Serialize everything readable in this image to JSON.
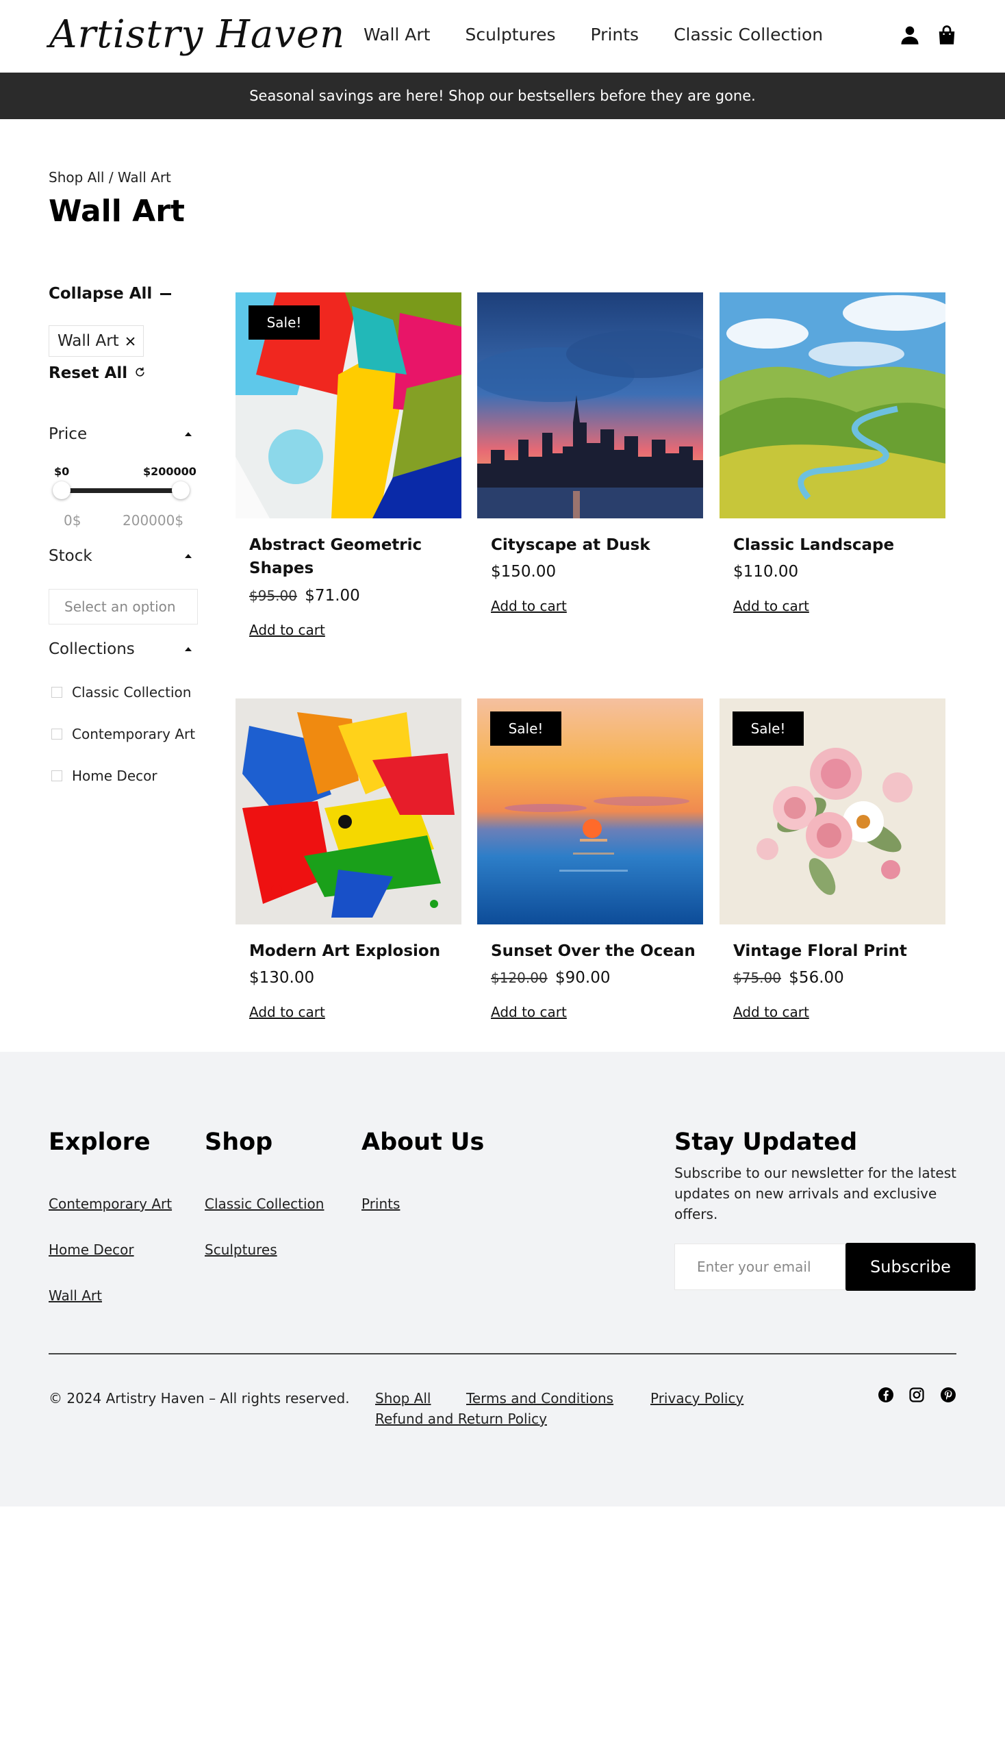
{
  "brand": {
    "logo": "Artistry Haven"
  },
  "nav": {
    "items": [
      "Wall Art",
      "Sculptures",
      "Prints",
      "Classic Collection"
    ]
  },
  "header_icons": [
    "user-icon",
    "shopping-bag-icon"
  ],
  "announcement": "Seasonal savings are here! Shop our bestsellers before they are gone.",
  "breadcrumb": "Shop All / Wall Art",
  "page_title": "Wall Art",
  "filters": {
    "collapse_all": "Collapse All",
    "active_chip": "Wall Art",
    "reset_all": "Reset All",
    "price": {
      "heading": "Price",
      "min_label": "$0",
      "max_label": "$200000",
      "range_min": "0$",
      "range_max": "200000$"
    },
    "stock": {
      "heading": "Stock",
      "placeholder": "Select an option"
    },
    "collections": {
      "heading": "Collections",
      "options": [
        "Classic Collection",
        "Contemporary Art",
        "Home Decor"
      ]
    }
  },
  "products": [
    {
      "name": "Abstract Geometric Shapes",
      "sale": true,
      "sale_label": "Sale!",
      "old_price": "$95.00",
      "price": "$71.00",
      "cta": "Add to cart"
    },
    {
      "name": "Cityscape at Dusk",
      "sale": false,
      "sale_label": "",
      "old_price": "",
      "price": "$150.00",
      "cta": "Add to cart"
    },
    {
      "name": "Classic Landscape",
      "sale": false,
      "sale_label": "",
      "old_price": "",
      "price": "$110.00",
      "cta": "Add to cart"
    },
    {
      "name": "Modern Art Explosion",
      "sale": false,
      "sale_label": "",
      "old_price": "",
      "price": "$130.00",
      "cta": "Add to cart"
    },
    {
      "name": "Sunset Over the Ocean",
      "sale": true,
      "sale_label": "Sale!",
      "old_price": "$120.00",
      "price": "$90.00",
      "cta": "Add to cart"
    },
    {
      "name": "Vintage Floral Print",
      "sale": true,
      "sale_label": "Sale!",
      "old_price": "$75.00",
      "price": "$56.00",
      "cta": "Add to cart"
    }
  ],
  "footer": {
    "explore": {
      "heading": "Explore",
      "links": [
        "Contemporary Art",
        "Home Decor",
        "Wall Art"
      ]
    },
    "shop": {
      "heading": "Shop",
      "links": [
        "Classic Collection",
        "Sculptures"
      ]
    },
    "about": {
      "heading": "About Us",
      "links": [
        "Prints"
      ]
    },
    "newsletter": {
      "heading": "Stay Updated",
      "description": "Subscribe to our newsletter for the latest updates on new arrivals and exclusive offers.",
      "placeholder": "Enter your email",
      "button": "Subscribe"
    },
    "copyright": "© 2024 Artistry Haven – All rights reserved.",
    "bottom_links": [
      "Shop All",
      "Terms and Conditions",
      "Privacy Policy",
      "Refund and Return Policy"
    ],
    "social": [
      "facebook-icon",
      "instagram-icon",
      "pinterest-icon"
    ]
  }
}
